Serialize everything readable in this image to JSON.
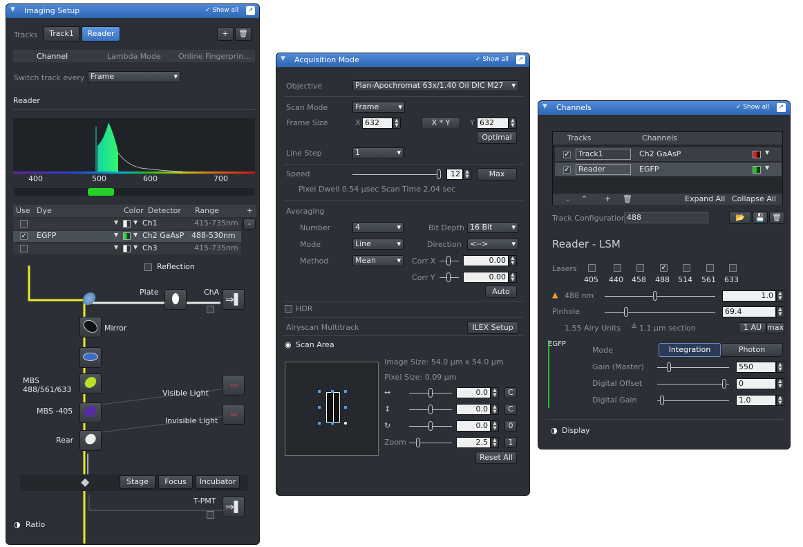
{
  "p1": {
    "title": "Imaging Setup",
    "show_all": "✓ Show all",
    "tracks_label": "Tracks",
    "track1": "Track1",
    "reader": "Reader",
    "add": "+",
    "del": "🗑",
    "tabs": [
      "Channel",
      "Lambda Mode",
      "Online Fingerprin..."
    ],
    "switch_label": "Switch track every",
    "switch_value": "Frame",
    "section": "Reader",
    "spectrum_ticks": [
      "400",
      "500",
      "600",
      "700"
    ],
    "table_headers": [
      "Use",
      "Dye",
      "Color",
      "Detector",
      "Range",
      "+"
    ],
    "rows": [
      {
        "dye": "",
        "detector": "Ch1",
        "range": "415-735nm",
        "checked": false
      },
      {
        "dye": "EGFP",
        "detector": "Ch2 GaAsP",
        "range": "488-530nm",
        "checked": true
      },
      {
        "dye": "",
        "detector": "Ch3",
        "range": "415-735nm",
        "checked": false
      }
    ],
    "minus": "-",
    "reflection": "Reflection",
    "plate": "Plate",
    "cha": "ChA",
    "mirror": "Mirror",
    "mbs1": "MBS\n488/561/633",
    "visible_light": "Visible Light",
    "mbs2": "MBS -405",
    "invisible_light": "Invisible Light",
    "rear": "Rear",
    "stage": "Stage",
    "focus": "Focus",
    "incubator": "Incubator",
    "tpmt": "T-PMT",
    "ratio": "Ratio",
    "colors": {
      "accent": "#3d6fbf",
      "laser": "#e8e82a",
      "emission": "#19c98a"
    }
  },
  "p2": {
    "title": "Acquisition Mode",
    "show_all": "✓ Show all",
    "objective_label": "Objective",
    "objective": "Plan-Apochromat 63x/1.40 Oil DIC M27",
    "scan_mode_label": "Scan Mode",
    "scan_mode": "Frame",
    "frame_size_label": "Frame Size",
    "x_label": "X",
    "x": "632",
    "xy": "X * Y",
    "y_label": "Y",
    "y": "632",
    "optimal": "Optimal",
    "line_step_label": "Line Step",
    "line_step": "1",
    "speed_label": "Speed",
    "speed": "12",
    "max": "Max",
    "pixel_dwell": "Pixel Dwell  0.54 µsec   Scan Time  2.04 sec",
    "averaging": "Averaging",
    "number_label": "Number",
    "number": "4",
    "bit_depth_label": "Bit Depth",
    "bit_depth": "16 Bit",
    "mode_label": "Mode",
    "mode": "Line",
    "direction_label": "Direction",
    "direction": "<-->",
    "method_label": "Method",
    "method": "Mean",
    "corr_x_label": "Corr X",
    "corr_x": "0.00",
    "corr_y_label": "Corr Y",
    "corr_y": "0.00",
    "auto": "Auto",
    "hdr": "HDR",
    "airyscan": "Airyscan Multitrack",
    "ilex": "ILEX Setup",
    "scan_area": "Scan Area",
    "image_size": "Image Size:  54.0 µm x 54.0 µm",
    "pixel_size": "Pixel Size:   0.09 µm",
    "offx": "0.0",
    "offy": "0.0",
    "rot": "0.0",
    "zoom_label": "Zoom",
    "zoom": "2.5",
    "c": "C",
    "zero": "0",
    "one": "1",
    "reset_all": "Reset All"
  },
  "p3": {
    "title": "Channels",
    "show_all": "✓ Show all",
    "col_tracks": "Tracks",
    "col_channels": "Channels",
    "rows": [
      {
        "track": "Track1",
        "channel": "Ch2 GaAsP",
        "color": "#d42020"
      },
      {
        "track": "Reader",
        "channel": "EGFP",
        "color": "#20c020"
      }
    ],
    "expand_all": "Expand All",
    "collapse_all": "Collapse All",
    "track_config_label": "Track Configuration",
    "track_config": "488",
    "heading": "Reader - LSM",
    "lasers_label": "Lasers",
    "lasers": [
      "405",
      "440",
      "458",
      "488",
      "514",
      "561",
      "633"
    ],
    "laser_on": "488",
    "laser_line": "488 nm",
    "laser_power": "1.0",
    "pinhole_label": "Pinhole",
    "pinhole": "69.4",
    "airy": "1.55 Airy Units",
    "section": "1.1 µm section",
    "one_au": "1 AU",
    "max": "max",
    "egfp": "EGFP",
    "mode_label": "Mode",
    "integration": "Integration",
    "photon": "Photon Counting",
    "gain_label": "Gain (Master)",
    "gain": "550",
    "offset_label": "Digital Offset",
    "offset": "0",
    "dgain_label": "Digital Gain",
    "dgain": "1.0",
    "display": "Display"
  }
}
